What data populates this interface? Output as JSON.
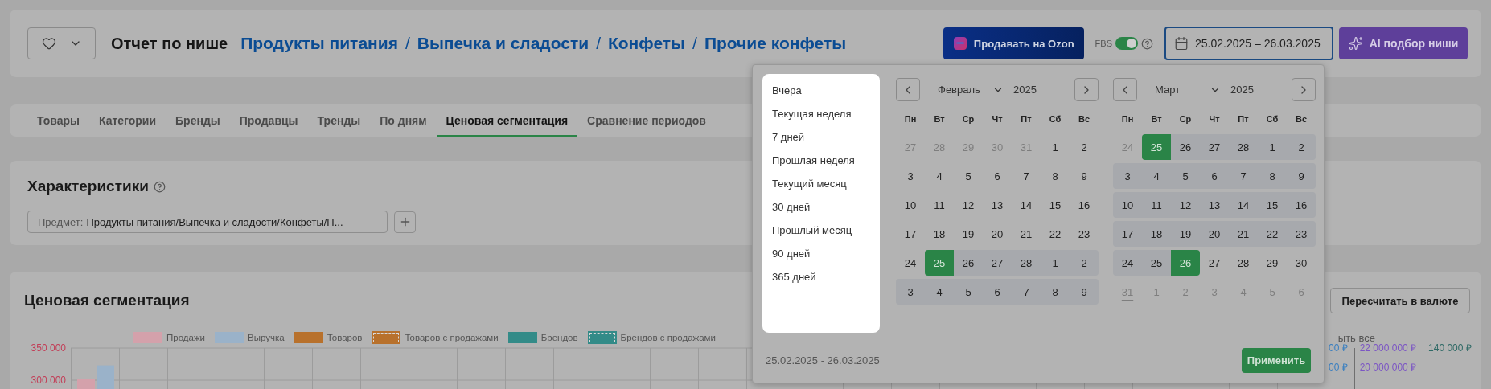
{
  "header": {
    "title": "Отчет по нише",
    "breadcrumbs": [
      {
        "label": "Продукты питания"
      },
      {
        "label": "Выпечка и сладости"
      },
      {
        "label": "Конфеты"
      },
      {
        "label": "Прочие конфеты"
      }
    ],
    "separators": [
      "/",
      "/",
      "/"
    ],
    "ozon_button": "Продавать на Ozon",
    "fbs": {
      "label": "FBS",
      "on": true
    },
    "date_field": {
      "value": "25.02.2025 – 26.03.2025"
    },
    "ai_button": "AI подбор ниши"
  },
  "tabs": [
    {
      "label": "Товары",
      "selected": false
    },
    {
      "label": "Категории",
      "selected": false
    },
    {
      "label": "Бренды",
      "selected": false
    },
    {
      "label": "Продавцы",
      "selected": false
    },
    {
      "label": "Тренды",
      "selected": false
    },
    {
      "label": "По дням",
      "selected": false
    },
    {
      "label": "Ценовая сегментация",
      "selected": true
    },
    {
      "label": "Сравнение периодов",
      "selected": false
    }
  ],
  "characteristics": {
    "title": "Характеристики",
    "filter": {
      "label": "Предмет:",
      "value": "Продукты питания/Выпечка и сладости/Конфеты/П..."
    }
  },
  "price_segmentation": {
    "title": "Ценовая сегментация",
    "convert_button": "Пересчитать в валюте",
    "hide_all": "ыть все",
    "chart_data": {
      "type": "bar",
      "ylim": [
        297800,
        350000
      ],
      "yticks": [
        {
          "value": 350000,
          "label": "350 000"
        },
        {
          "value": 300000,
          "label": "300 000"
        }
      ],
      "series": [
        {
          "name": "Продажи",
          "color": "#d4a1ab",
          "values": [
            302000
          ]
        },
        {
          "name": "Выручка",
          "color": "#9ab2c9",
          "values": [
            323000
          ]
        },
        {
          "name": "Товаров",
          "color": "#b8712c",
          "values": [
            null
          ]
        },
        {
          "name": "Товаров с продажами",
          "color": "#b8712c",
          "values": [
            null
          ]
        },
        {
          "name": "Брендов",
          "color": "#338b88",
          "values": [
            null
          ]
        },
        {
          "name": "Брендов с продажами",
          "color": "#338b88",
          "values": [
            null
          ]
        }
      ]
    },
    "legend": [
      {
        "hidden": false,
        "dashed": false
      },
      {
        "hidden": false,
        "dashed": false
      },
      {
        "hidden": true,
        "dashed": false
      },
      {
        "hidden": true,
        "dashed": true
      },
      {
        "hidden": true,
        "dashed": false
      },
      {
        "hidden": true,
        "dashed": true
      }
    ],
    "right_axes": [
      {
        "color": "#3a7fc0",
        "ticks": [
          "00 ₽",
          "00 ₽"
        ]
      },
      {
        "color": "#7b55c4",
        "ticks": [
          "22 000 000 ₽",
          "20 000 000 ₽"
        ]
      },
      {
        "color": "#2f6a66",
        "ticks": [
          "140 000 ₽"
        ]
      }
    ]
  },
  "date_popup": {
    "presets": [
      "Вчера",
      "Текущая неделя",
      "7 дней",
      "Прошлая неделя",
      "Текущий месяц",
      "30 дней",
      "Прошлый месяц",
      "90 дней",
      "365 дней"
    ],
    "months": [
      {
        "month": "Февраль",
        "year": "2025",
        "weekdays": [
          "Пн",
          "Вт",
          "Ср",
          "Чт",
          "Пт",
          "Сб",
          "Вс"
        ],
        "weeks": [
          [
            {
              "d": "27",
              "muted": true,
              "range": false,
              "selected": false,
              "today": false
            },
            {
              "d": "28",
              "muted": true,
              "range": false,
              "selected": false,
              "today": false
            },
            {
              "d": "29",
              "muted": true,
              "range": false,
              "selected": false,
              "today": false
            },
            {
              "d": "30",
              "muted": true,
              "range": false,
              "selected": false,
              "today": false
            },
            {
              "d": "31",
              "muted": true,
              "range": false,
              "selected": false,
              "today": false
            },
            {
              "d": "1",
              "muted": false,
              "range": false,
              "selected": false,
              "today": false
            },
            {
              "d": "2",
              "muted": false,
              "range": false,
              "selected": false,
              "today": false
            }
          ],
          [
            {
              "d": "3",
              "muted": false,
              "range": false,
              "selected": false,
              "today": false
            },
            {
              "d": "4",
              "muted": false,
              "range": false,
              "selected": false,
              "today": false
            },
            {
              "d": "5",
              "muted": false,
              "range": false,
              "selected": false,
              "today": false
            },
            {
              "d": "6",
              "muted": false,
              "range": false,
              "selected": false,
              "today": false
            },
            {
              "d": "7",
              "muted": false,
              "range": false,
              "selected": false,
              "today": false
            },
            {
              "d": "8",
              "muted": false,
              "range": false,
              "selected": false,
              "today": false
            },
            {
              "d": "9",
              "muted": false,
              "range": false,
              "selected": false,
              "today": false
            }
          ],
          [
            {
              "d": "10",
              "muted": false,
              "range": false,
              "selected": false,
              "today": false
            },
            {
              "d": "11",
              "muted": false,
              "range": false,
              "selected": false,
              "today": false
            },
            {
              "d": "12",
              "muted": false,
              "range": false,
              "selected": false,
              "today": false
            },
            {
              "d": "13",
              "muted": false,
              "range": false,
              "selected": false,
              "today": false
            },
            {
              "d": "14",
              "muted": false,
              "range": false,
              "selected": false,
              "today": false
            },
            {
              "d": "15",
              "muted": false,
              "range": false,
              "selected": false,
              "today": false
            },
            {
              "d": "16",
              "muted": false,
              "range": false,
              "selected": false,
              "today": false
            }
          ],
          [
            {
              "d": "17",
              "muted": false,
              "range": false,
              "selected": false,
              "today": false
            },
            {
              "d": "18",
              "muted": false,
              "range": false,
              "selected": false,
              "today": false
            },
            {
              "d": "19",
              "muted": false,
              "range": false,
              "selected": false,
              "today": false
            },
            {
              "d": "20",
              "muted": false,
              "range": false,
              "selected": false,
              "today": false
            },
            {
              "d": "21",
              "muted": false,
              "range": false,
              "selected": false,
              "today": false
            },
            {
              "d": "22",
              "muted": false,
              "range": false,
              "selected": false,
              "today": false
            },
            {
              "d": "23",
              "muted": false,
              "range": false,
              "selected": false,
              "today": false
            }
          ],
          [
            {
              "d": "24",
              "muted": false,
              "range": false,
              "selected": false,
              "today": false
            },
            {
              "d": "25",
              "muted": false,
              "range": false,
              "selected": true,
              "today": false
            },
            {
              "d": "26",
              "muted": false,
              "range": true,
              "selected": false,
              "today": false
            },
            {
              "d": "27",
              "muted": false,
              "range": true,
              "selected": false,
              "today": false
            },
            {
              "d": "28",
              "muted": false,
              "range": true,
              "selected": false,
              "today": false
            },
            {
              "d": "1",
              "muted": false,
              "range": true,
              "selected": false,
              "today": false
            },
            {
              "d": "2",
              "muted": false,
              "range": true,
              "selected": false,
              "today": false
            }
          ],
          [
            {
              "d": "3",
              "muted": false,
              "range": true,
              "selected": false,
              "today": false
            },
            {
              "d": "4",
              "muted": false,
              "range": true,
              "selected": false,
              "today": false
            },
            {
              "d": "5",
              "muted": false,
              "range": true,
              "selected": false,
              "today": false
            },
            {
              "d": "6",
              "muted": false,
              "range": true,
              "selected": false,
              "today": false
            },
            {
              "d": "7",
              "muted": false,
              "range": true,
              "selected": false,
              "today": false
            },
            {
              "d": "8",
              "muted": false,
              "range": true,
              "selected": false,
              "today": false
            },
            {
              "d": "9",
              "muted": false,
              "range": true,
              "selected": false,
              "today": false
            }
          ]
        ]
      },
      {
        "month": "Март",
        "year": "2025",
        "weekdays": [
          "Пн",
          "Вт",
          "Ср",
          "Чт",
          "Пт",
          "Сб",
          "Вс"
        ],
        "weeks": [
          [
            {
              "d": "24",
              "muted": true,
              "range": false,
              "selected": false,
              "today": false
            },
            {
              "d": "25",
              "muted": false,
              "range": false,
              "selected": true,
              "today": false
            },
            {
              "d": "26",
              "muted": false,
              "range": true,
              "selected": false,
              "today": false
            },
            {
              "d": "27",
              "muted": false,
              "range": true,
              "selected": false,
              "today": false
            },
            {
              "d": "28",
              "muted": false,
              "range": true,
              "selected": false,
              "today": false
            },
            {
              "d": "1",
              "muted": false,
              "range": true,
              "selected": false,
              "today": false
            },
            {
              "d": "2",
              "muted": false,
              "range": true,
              "selected": false,
              "today": false
            }
          ],
          [
            {
              "d": "3",
              "muted": false,
              "range": true,
              "selected": false,
              "today": false
            },
            {
              "d": "4",
              "muted": false,
              "range": true,
              "selected": false,
              "today": false
            },
            {
              "d": "5",
              "muted": false,
              "range": true,
              "selected": false,
              "today": false
            },
            {
              "d": "6",
              "muted": false,
              "range": true,
              "selected": false,
              "today": false
            },
            {
              "d": "7",
              "muted": false,
              "range": true,
              "selected": false,
              "today": false
            },
            {
              "d": "8",
              "muted": false,
              "range": true,
              "selected": false,
              "today": false
            },
            {
              "d": "9",
              "muted": false,
              "range": true,
              "selected": false,
              "today": false
            }
          ],
          [
            {
              "d": "10",
              "muted": false,
              "range": true,
              "selected": false,
              "today": false
            },
            {
              "d": "11",
              "muted": false,
              "range": true,
              "selected": false,
              "today": false
            },
            {
              "d": "12",
              "muted": false,
              "range": true,
              "selected": false,
              "today": false
            },
            {
              "d": "13",
              "muted": false,
              "range": true,
              "selected": false,
              "today": false
            },
            {
              "d": "14",
              "muted": false,
              "range": true,
              "selected": false,
              "today": false
            },
            {
              "d": "15",
              "muted": false,
              "range": true,
              "selected": false,
              "today": false
            },
            {
              "d": "16",
              "muted": false,
              "range": true,
              "selected": false,
              "today": false
            }
          ],
          [
            {
              "d": "17",
              "muted": false,
              "range": true,
              "selected": false,
              "today": false
            },
            {
              "d": "18",
              "muted": false,
              "range": true,
              "selected": false,
              "today": false
            },
            {
              "d": "19",
              "muted": false,
              "range": true,
              "selected": false,
              "today": false
            },
            {
              "d": "20",
              "muted": false,
              "range": true,
              "selected": false,
              "today": false
            },
            {
              "d": "21",
              "muted": false,
              "range": true,
              "selected": false,
              "today": false
            },
            {
              "d": "22",
              "muted": false,
              "range": true,
              "selected": false,
              "today": false
            },
            {
              "d": "23",
              "muted": false,
              "range": true,
              "selected": false,
              "today": false
            }
          ],
          [
            {
              "d": "24",
              "muted": false,
              "range": true,
              "selected": false,
              "today": false
            },
            {
              "d": "25",
              "muted": false,
              "range": true,
              "selected": false,
              "today": false
            },
            {
              "d": "26",
              "muted": false,
              "range": false,
              "selected": true,
              "today": false
            },
            {
              "d": "27",
              "muted": false,
              "range": false,
              "selected": false,
              "today": false
            },
            {
              "d": "28",
              "muted": false,
              "range": false,
              "selected": false,
              "today": false
            },
            {
              "d": "29",
              "muted": false,
              "range": false,
              "selected": false,
              "today": false
            },
            {
              "d": "30",
              "muted": false,
              "range": false,
              "selected": false,
              "today": false
            }
          ],
          [
            {
              "d": "31",
              "muted": true,
              "range": false,
              "selected": false,
              "today": true
            },
            {
              "d": "1",
              "muted": true,
              "range": false,
              "selected": false,
              "today": false
            },
            {
              "d": "2",
              "muted": true,
              "range": false,
              "selected": false,
              "today": false
            },
            {
              "d": "3",
              "muted": true,
              "range": false,
              "selected": false,
              "today": false
            },
            {
              "d": "4",
              "muted": true,
              "range": false,
              "selected": false,
              "today": false
            },
            {
              "d": "5",
              "muted": true,
              "range": false,
              "selected": false,
              "today": false
            },
            {
              "d": "6",
              "muted": true,
              "range": false,
              "selected": false,
              "today": false
            }
          ]
        ]
      }
    ],
    "footer_range": "25.02.2025 - 26.03.2025",
    "apply_button": "Применить"
  }
}
